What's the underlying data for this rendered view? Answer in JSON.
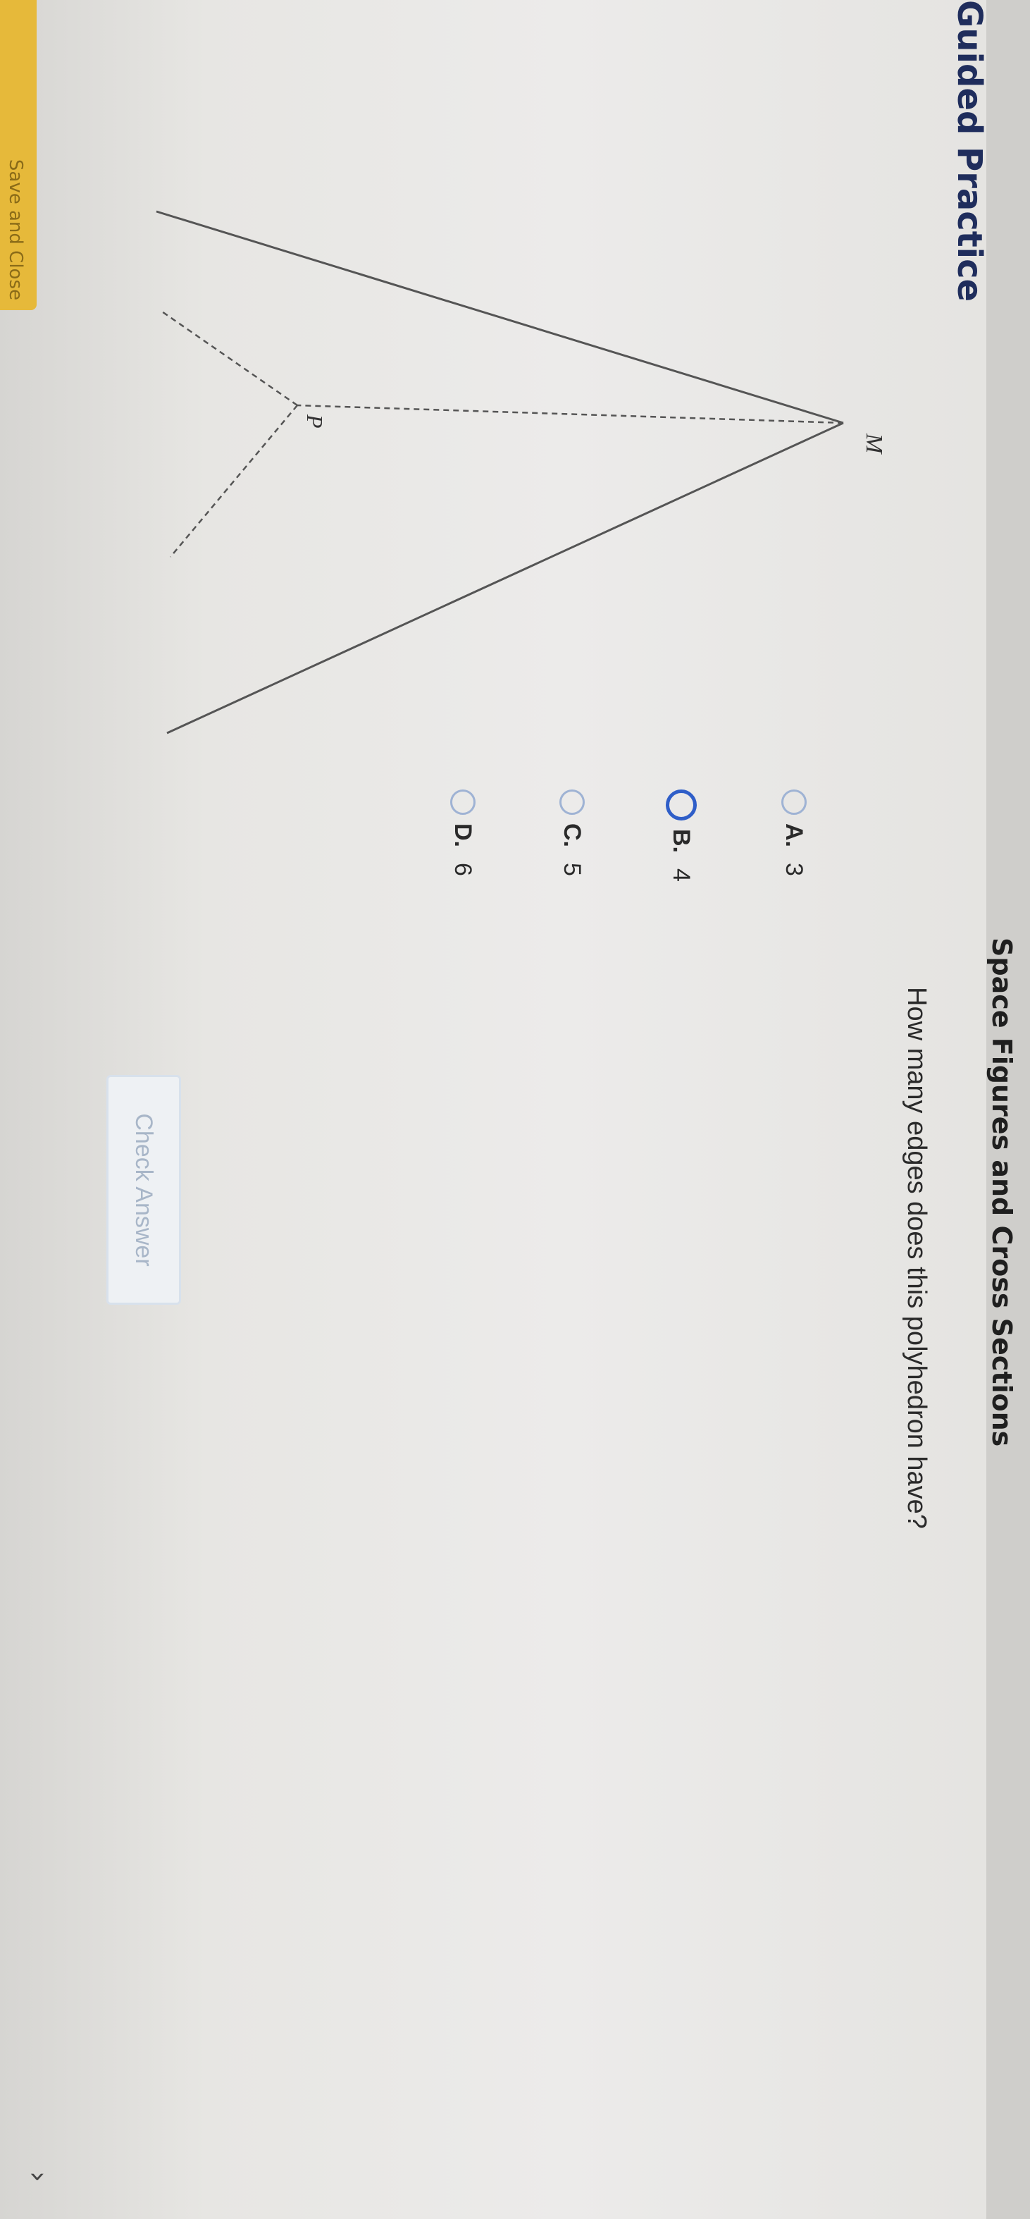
{
  "header": {
    "title": "Space Figures and Cross Sections"
  },
  "section": {
    "label": "Guided Practice"
  },
  "footer": {
    "save_label": "Save and Close"
  },
  "figure": {
    "point_labels": [
      "M",
      "P"
    ]
  },
  "question": {
    "prompt": "How many edges does this polyhedron have?",
    "choices": [
      {
        "letter": "A.",
        "value": "3",
        "selected": false
      },
      {
        "letter": "B.",
        "value": "4",
        "selected": true
      },
      {
        "letter": "C.",
        "value": "5",
        "selected": false
      },
      {
        "letter": "D.",
        "value": "6",
        "selected": false
      }
    ],
    "check_label": "Check Answer"
  },
  "nav": {
    "chevron_icon": "chevron-right-icon"
  }
}
